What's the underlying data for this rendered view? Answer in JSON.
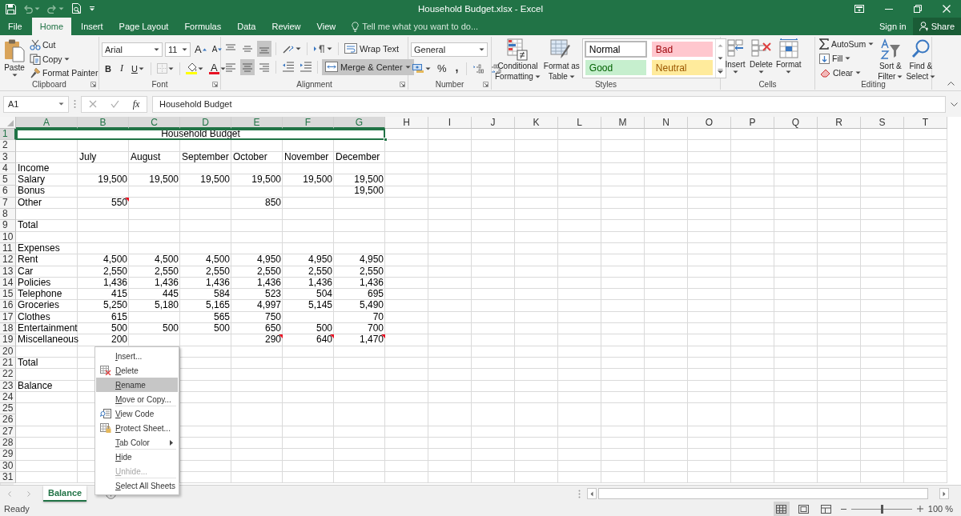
{
  "window": {
    "title": "Household Budget.xlsx - Excel"
  },
  "ribbon_tabs": [
    {
      "label": "File",
      "selected": false
    },
    {
      "label": "Home",
      "selected": true
    },
    {
      "label": "Insert",
      "selected": false
    },
    {
      "label": "Page Layout",
      "selected": false
    },
    {
      "label": "Formulas",
      "selected": false
    },
    {
      "label": "Data",
      "selected": false
    },
    {
      "label": "Review",
      "selected": false
    },
    {
      "label": "View",
      "selected": false
    }
  ],
  "tell_me": {
    "placeholder": "Tell me what you want to do..."
  },
  "account": {
    "sign_in": "Sign in",
    "share": "Share"
  },
  "clipboard": {
    "label": "Clipboard",
    "paste": "Paste",
    "cut": "Cut",
    "copy": "Copy",
    "format_painter": "Format Painter"
  },
  "font": {
    "label": "Font",
    "font_name": "Arial",
    "font_size": "11",
    "grow": "A",
    "shrink": "A",
    "bold": "B",
    "italic": "I",
    "underline": "U",
    "font_color": "A"
  },
  "alignment": {
    "label": "Alignment",
    "align_buttons": [
      {
        "kind": "top",
        "on": false
      },
      {
        "kind": "middle",
        "on": false
      },
      {
        "kind": "bottom",
        "on": true
      },
      {
        "kind": "left",
        "on": false
      },
      {
        "kind": "center",
        "on": true
      },
      {
        "kind": "right",
        "on": false
      }
    ],
    "wrap_text": "Wrap Text",
    "merge_center": {
      "label": "Merge & Center",
      "on": true
    }
  },
  "number": {
    "label": "Number",
    "format": "General",
    "percent": "%",
    "comma": ","
  },
  "styles": {
    "label": "Styles",
    "conditional": [
      "Conditional",
      "Formatting"
    ],
    "format_table": [
      "Format as",
      "Table"
    ],
    "cell_styles": [
      {
        "label": "Normal",
        "kind": "normal",
        "color": "#ffffff",
        "selected": true
      },
      {
        "label": "Bad",
        "kind": "bad",
        "color": "#ffc7ce",
        "selected": false
      },
      {
        "label": "Good",
        "kind": "good",
        "color": "#c6efce",
        "selected": false
      },
      {
        "label": "Neutral",
        "kind": "neutral",
        "color": "#ffeb9c",
        "selected": false
      }
    ]
  },
  "cells": {
    "label": "Cells",
    "buttons": [
      {
        "label": "Insert",
        "kind": "insert"
      },
      {
        "label": "Delete",
        "kind": "delete"
      },
      {
        "label": "Format",
        "kind": "format"
      }
    ]
  },
  "editing": {
    "label": "Editing",
    "autosum": "AutoSum",
    "fill": "Fill",
    "clear": "Clear",
    "sort": [
      "Sort &",
      "Filter"
    ],
    "find": [
      "Find &",
      "Select"
    ]
  },
  "formula_bar": {
    "name_box": "A1",
    "fx": "fx",
    "content": "Household Budget"
  },
  "sheet": {
    "columns": [
      {
        "label": "A",
        "selected": true
      },
      {
        "label": "B",
        "selected": true
      },
      {
        "label": "C",
        "selected": true
      },
      {
        "label": "D",
        "selected": true
      },
      {
        "label": "E",
        "selected": true
      },
      {
        "label": "F",
        "selected": true
      },
      {
        "label": "G",
        "selected": true
      },
      {
        "label": "H",
        "selected": false
      },
      {
        "label": "I",
        "selected": false
      },
      {
        "label": "J",
        "selected": false
      },
      {
        "label": "K",
        "selected": false
      },
      {
        "label": "L",
        "selected": false
      },
      {
        "label": "M",
        "selected": false
      },
      {
        "label": "N",
        "selected": false
      },
      {
        "label": "O",
        "selected": false
      },
      {
        "label": "P",
        "selected": false
      },
      {
        "label": "Q",
        "selected": false
      },
      {
        "label": "R",
        "selected": false
      },
      {
        "label": "S",
        "selected": false
      },
      {
        "label": "T",
        "selected": false
      }
    ],
    "rows": [
      {
        "number": "1",
        "selected": true,
        "kind": "title",
        "title": "Household Budget"
      },
      {
        "number": "2",
        "selected": false,
        "kind": "data"
      },
      {
        "number": "3",
        "selected": false,
        "kind": "months",
        "cells": {
          "B": {
            "text": "July",
            "comment": false
          },
          "C": {
            "text": "August",
            "comment": false
          },
          "D": {
            "text": "September",
            "comment": false
          },
          "E": {
            "text": "October",
            "comment": false
          },
          "F": {
            "text": "November",
            "comment": false
          },
          "G": {
            "text": "December",
            "comment": false
          }
        }
      },
      {
        "number": "4",
        "selected": false,
        "kind": "data",
        "cells": {
          "A": {
            "text": "Income",
            "comment": false
          }
        }
      },
      {
        "number": "5",
        "selected": false,
        "kind": "data",
        "cells": {
          "A": {
            "text": "Salary",
            "comment": false
          },
          "B": {
            "text": "19,500",
            "comment": false
          },
          "C": {
            "text": "19,500",
            "comment": false
          },
          "D": {
            "text": "19,500",
            "comment": false
          },
          "E": {
            "text": "19,500",
            "comment": false
          },
          "F": {
            "text": "19,500",
            "comment": false
          },
          "G": {
            "text": "19,500",
            "comment": false
          }
        }
      },
      {
        "number": "6",
        "selected": false,
        "kind": "data",
        "cells": {
          "A": {
            "text": "Bonus",
            "comment": false
          },
          "G": {
            "text": "19,500",
            "comment": false
          }
        }
      },
      {
        "number": "7",
        "selected": false,
        "kind": "data",
        "cells": {
          "A": {
            "text": "Other",
            "comment": false
          },
          "B": {
            "text": "550",
            "comment": true
          },
          "E": {
            "text": "850",
            "comment": false
          }
        }
      },
      {
        "number": "8",
        "selected": false,
        "kind": "data"
      },
      {
        "number": "9",
        "selected": false,
        "kind": "data",
        "cells": {
          "A": {
            "text": "Total",
            "comment": false
          }
        }
      },
      {
        "number": "10",
        "selected": false,
        "kind": "data"
      },
      {
        "number": "11",
        "selected": false,
        "kind": "data",
        "cells": {
          "A": {
            "text": "Expenses",
            "comment": false
          }
        }
      },
      {
        "number": "12",
        "selected": false,
        "kind": "data",
        "cells": {
          "A": {
            "text": "Rent",
            "comment": false
          },
          "B": {
            "text": "4,500",
            "comment": false
          },
          "C": {
            "text": "4,500",
            "comment": false
          },
          "D": {
            "text": "4,500",
            "comment": false
          },
          "E": {
            "text": "4,950",
            "comment": false
          },
          "F": {
            "text": "4,950",
            "comment": false
          },
          "G": {
            "text": "4,950",
            "comment": false
          }
        }
      },
      {
        "number": "13",
        "selected": false,
        "kind": "data",
        "cells": {
          "A": {
            "text": "Car",
            "comment": false
          },
          "B": {
            "text": "2,550",
            "comment": false
          },
          "C": {
            "text": "2,550",
            "comment": false
          },
          "D": {
            "text": "2,550",
            "comment": false
          },
          "E": {
            "text": "2,550",
            "comment": false
          },
          "F": {
            "text": "2,550",
            "comment": false
          },
          "G": {
            "text": "2,550",
            "comment": false
          }
        }
      },
      {
        "number": "14",
        "selected": false,
        "kind": "data",
        "cells": {
          "A": {
            "text": "Policies",
            "comment": false
          },
          "B": {
            "text": "1,436",
            "comment": false
          },
          "C": {
            "text": "1,436",
            "comment": false
          },
          "D": {
            "text": "1,436",
            "comment": false
          },
          "E": {
            "text": "1,436",
            "comment": false
          },
          "F": {
            "text": "1,436",
            "comment": false
          },
          "G": {
            "text": "1,436",
            "comment": false
          }
        }
      },
      {
        "number": "15",
        "selected": false,
        "kind": "data",
        "cells": {
          "A": {
            "text": "Telephone",
            "comment": false
          },
          "B": {
            "text": "415",
            "comment": false
          },
          "C": {
            "text": "445",
            "comment": false
          },
          "D": {
            "text": "584",
            "comment": false
          },
          "E": {
            "text": "523",
            "comment": false
          },
          "F": {
            "text": "504",
            "comment": false
          },
          "G": {
            "text": "695",
            "comment": false
          }
        }
      },
      {
        "number": "16",
        "selected": false,
        "kind": "data",
        "cells": {
          "A": {
            "text": "Groceries",
            "comment": false
          },
          "B": {
            "text": "5,250",
            "comment": false
          },
          "C": {
            "text": "5,180",
            "comment": false
          },
          "D": {
            "text": "5,165",
            "comment": false
          },
          "E": {
            "text": "4,997",
            "comment": false
          },
          "F": {
            "text": "5,145",
            "comment": false
          },
          "G": {
            "text": "5,490",
            "comment": false
          }
        }
      },
      {
        "number": "17",
        "selected": false,
        "kind": "data",
        "cells": {
          "A": {
            "text": "Clothes",
            "comment": false
          },
          "B": {
            "text": "615",
            "comment": false
          },
          "D": {
            "text": "565",
            "comment": false
          },
          "E": {
            "text": "750",
            "comment": false
          },
          "G": {
            "text": "70",
            "comment": false
          }
        }
      },
      {
        "number": "18",
        "selected": false,
        "kind": "data",
        "cells": {
          "A": {
            "text": "Entertainment",
            "comment": false
          },
          "B": {
            "text": "500",
            "comment": false
          },
          "C": {
            "text": "500",
            "comment": false
          },
          "D": {
            "text": "500",
            "comment": false
          },
          "E": {
            "text": "650",
            "comment": false
          },
          "F": {
            "text": "500",
            "comment": false
          },
          "G": {
            "text": "700",
            "comment": false
          }
        }
      },
      {
        "number": "19",
        "selected": false,
        "kind": "data",
        "cells": {
          "A": {
            "text": "Miscellaneous",
            "comment": false
          },
          "B": {
            "text": "200",
            "comment": false
          },
          "E": {
            "text": "290",
            "comment": true
          },
          "F": {
            "text": "640",
            "comment": true
          },
          "G": {
            "text": "1,470",
            "comment": true
          }
        }
      },
      {
        "number": "20",
        "selected": false,
        "kind": "data"
      },
      {
        "number": "21",
        "selected": false,
        "kind": "data",
        "cells": {
          "A": {
            "text": "Total",
            "comment": false
          }
        }
      },
      {
        "number": "22",
        "selected": false,
        "kind": "data"
      },
      {
        "number": "23",
        "selected": false,
        "kind": "data",
        "cells": {
          "A": {
            "text": "Balance",
            "comment": false
          }
        }
      },
      {
        "number": "24",
        "selected": false,
        "kind": "data"
      },
      {
        "number": "25",
        "selected": false,
        "kind": "data"
      },
      {
        "number": "26",
        "selected": false,
        "kind": "data"
      },
      {
        "number": "27",
        "selected": false,
        "kind": "data"
      },
      {
        "number": "28",
        "selected": false,
        "kind": "data"
      },
      {
        "number": "29",
        "selected": false,
        "kind": "data"
      },
      {
        "number": "30",
        "selected": false,
        "kind": "data"
      },
      {
        "number": "31",
        "selected": false,
        "kind": "data"
      }
    ]
  },
  "context_menu": [
    {
      "label": "Insert...",
      "kind": "plain",
      "selected": false,
      "disabled": false,
      "separator": false
    },
    {
      "label": "Delete",
      "kind": "delete",
      "selected": false,
      "disabled": false,
      "separator": false
    },
    {
      "label": "Rename",
      "kind": "plain",
      "selected": true,
      "disabled": false,
      "separator": false
    },
    {
      "label": "Move or Copy...",
      "kind": "plain",
      "selected": false,
      "disabled": false,
      "separator": true
    },
    {
      "label": "View Code",
      "kind": "view_code",
      "selected": false,
      "disabled": false,
      "separator": false
    },
    {
      "label": "Protect Sheet...",
      "kind": "protect",
      "selected": false,
      "disabled": false,
      "separator": false
    },
    {
      "label": "Tab Color",
      "kind": "submenu",
      "selected": false,
      "disabled": false,
      "separator": true
    },
    {
      "label": "Hide",
      "kind": "plain",
      "selected": false,
      "disabled": false,
      "separator": false
    },
    {
      "label": "Unhide...",
      "kind": "plain",
      "selected": false,
      "disabled": true,
      "separator": true
    },
    {
      "label": "Select All Sheets",
      "kind": "plain",
      "selected": false,
      "disabled": false,
      "separator": false
    }
  ],
  "sheet_tabs": [
    {
      "label": "Balance",
      "selected": true
    }
  ],
  "status_bar": {
    "status": "Ready",
    "views": [
      {
        "kind": "normal",
        "selected": true
      },
      {
        "kind": "page_layout",
        "selected": false
      },
      {
        "kind": "page_break",
        "selected": false
      }
    ],
    "zoom": {
      "level": 0.5,
      "label": "100 %"
    }
  }
}
